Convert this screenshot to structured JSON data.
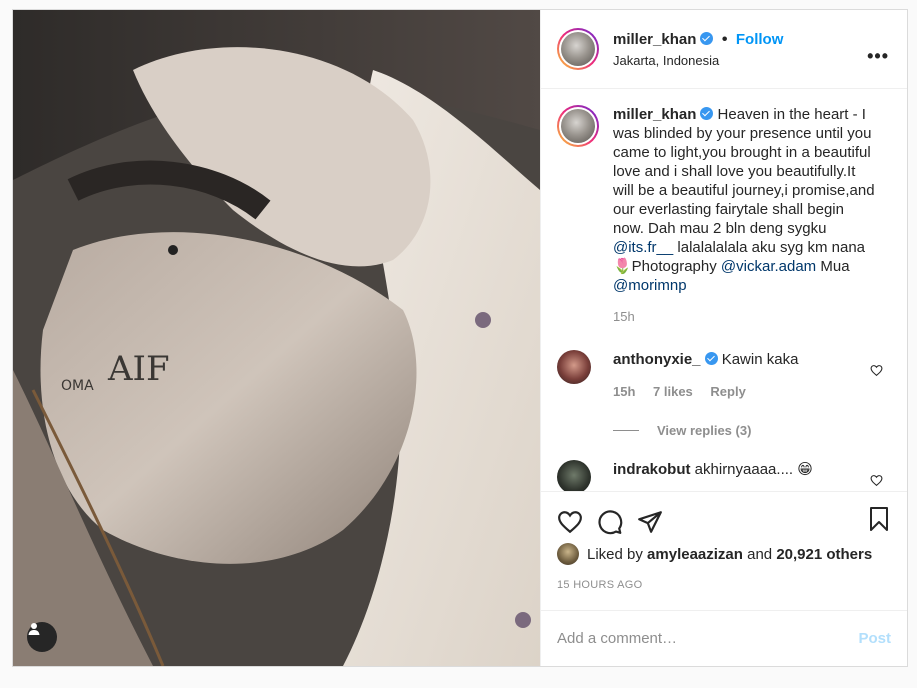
{
  "post": {
    "author": {
      "username": "miller_khan",
      "follow_label": "Follow",
      "dot": "•",
      "location": "Jakarta, Indonesia",
      "more_label": "•••"
    },
    "caption": {
      "username": "miller_khan",
      "text_part1": "Heaven in the heart - I was blinded by your presence until you came to light,you brought in a beautiful love and i shall love you beautifully.It will be a beautiful journey,i promise,and our everlasting fairytale shall begin now. Dah mau 2 bln deng sygku ",
      "mention1": "@its.fr__",
      "text_part2": " lalalalalala aku syg km nana 🌷Photography ",
      "mention2": "@vickar.adam",
      "text_part3": " Mua ",
      "mention3": "@morimnp",
      "time": "15h"
    },
    "comments": [
      {
        "username": "anthonyxie_",
        "text": "Kawin kaka",
        "time": "15h",
        "likes": "7 likes",
        "reply_label": "Reply",
        "view_replies": "View replies (3)"
      },
      {
        "username": "indrakobut",
        "text": "akhirnyaaaa.... 😁"
      }
    ],
    "likes": {
      "prefix": "Liked by ",
      "user": "amyleaazizan",
      "middle": " and ",
      "count": "20,921 others"
    },
    "timestamp": "15 HOURS AGO",
    "add_comment": {
      "placeholder": "Add a comment…",
      "post_label": "Post"
    },
    "colors": {
      "accent": "#0095f6",
      "mention": "#00376b",
      "verified": "#3897f0",
      "muted": "#8e8e8e"
    }
  }
}
